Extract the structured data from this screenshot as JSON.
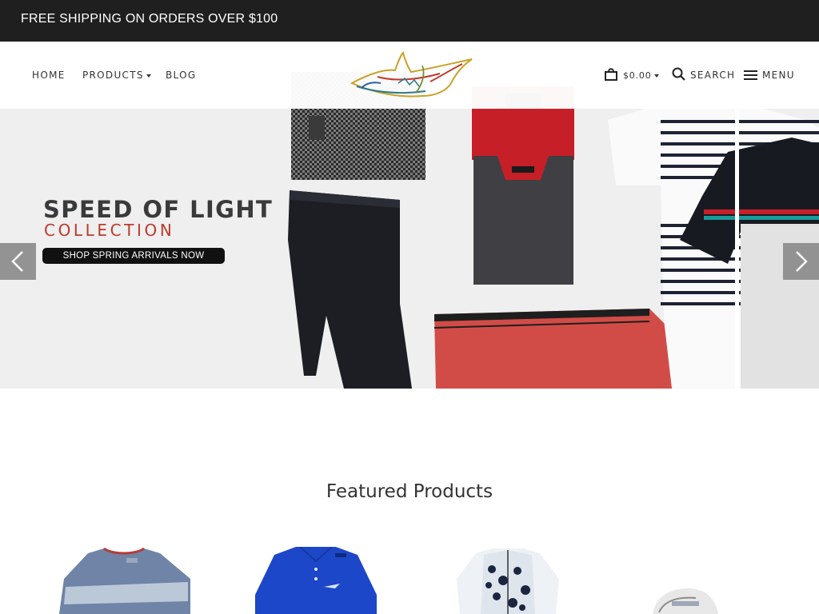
{
  "promo": {
    "text": "FREE SHIPPING ON ORDERS OVER $100"
  },
  "nav": {
    "home": "HOME",
    "products": "PRODUCTS",
    "blog": "BLOG",
    "cart_total": "$0.00",
    "search": "SEARCH",
    "menu": "MENU"
  },
  "brand": {
    "logo": "shark-logo"
  },
  "hero": {
    "title": "SPEED OF LIGHT",
    "subtitle": "COLLECTION",
    "cta": "SHOP  SPRING ARRIVALS NOW",
    "prev_icon": "chevron-left-icon",
    "next_icon": "chevron-right-icon"
  },
  "featured": {
    "title": "Featured Products",
    "products": [
      {
        "name": "heather-tee",
        "color": "#6f84a6"
      },
      {
        "name": "blue-polo",
        "color": "#1d47c9"
      },
      {
        "name": "leopard-quarter-zip",
        "color": "#e9eef3"
      },
      {
        "name": "white-cap",
        "color": "#e8e8e8"
      }
    ]
  },
  "colors": {
    "accent": "#c0392b",
    "dark": "#1f1f1f"
  }
}
